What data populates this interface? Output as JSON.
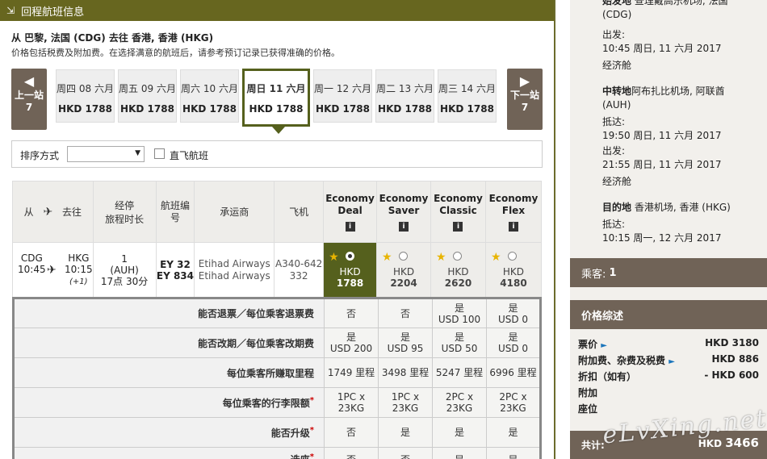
{
  "header": {
    "title": "回程航班信息",
    "icon": "collapse-arrow-icon"
  },
  "route": "从 巴黎, 法国 (CDG) 去往 香港, 香港 (HKG)",
  "note": "价格包括税费及附加费。在选择满意的航班后，请参考预订记录已获得准确的价格。",
  "nav": {
    "prev": [
      "上一站",
      "7"
    ],
    "next": [
      "下一站",
      "7"
    ]
  },
  "dates": [
    {
      "label": "周四 08 六月",
      "price": "HKD 1788"
    },
    {
      "label": "周五 09 六月",
      "price": "HKD 1788"
    },
    {
      "label": "周六 10 六月",
      "price": "HKD 1788"
    },
    {
      "label": "周日 11 六月",
      "price": "HKD 1788",
      "selected": true
    },
    {
      "label": "周一 12 六月",
      "price": "HKD 1788"
    },
    {
      "label": "周二 13 六月",
      "price": "HKD 1788"
    },
    {
      "label": "周三 14 六月",
      "price": "HKD 1788"
    }
  ],
  "sort": {
    "label": "排序方式",
    "value": "",
    "direct_label": "直飞航班"
  },
  "table": {
    "headers": {
      "from": "从",
      "to": "去往",
      "stops": "经停",
      "duration": "旅程时长",
      "flightno": "航班编号",
      "carrier": "承运商",
      "aircraft": "飞机"
    },
    "fares": [
      {
        "name": [
          "Economy",
          "Deal"
        ],
        "currency": "HKD",
        "price": "1788",
        "selected": true
      },
      {
        "name": [
          "Economy",
          "Saver"
        ],
        "currency": "HKD",
        "price": "2204"
      },
      {
        "name": [
          "Economy",
          "Classic"
        ],
        "currency": "HKD",
        "price": "2620"
      },
      {
        "name": [
          "Economy",
          "Flex"
        ],
        "currency": "HKD",
        "price": "4180"
      }
    ],
    "flight": {
      "from_code": "CDG",
      "from_time": "10:45",
      "to_code": "HKG",
      "to_time": "10:15",
      "to_day": "(+1)",
      "stops": "1",
      "via": "(AUH)",
      "duration": "17点 30分",
      "flightnos": [
        "EY 32",
        "EY 834"
      ],
      "carriers": [
        "Etihad Airways",
        "Etihad Airways"
      ],
      "aircraft": [
        "A340-642",
        "332"
      ]
    }
  },
  "details": [
    {
      "q": "能否退票／每位乘客退票费",
      "v": [
        [
          "否"
        ],
        [
          "否"
        ],
        [
          "是",
          "USD 100"
        ],
        [
          "是",
          "USD 0"
        ]
      ]
    },
    {
      "q": "能否改期／每位乘客改期费",
      "v": [
        [
          "是",
          "USD 200"
        ],
        [
          "是",
          "USD 95"
        ],
        [
          "是",
          "USD 50"
        ],
        [
          "是",
          "USD 0"
        ]
      ]
    },
    {
      "q": "每位乘客所赚取里程",
      "v": [
        [
          "1749 里程"
        ],
        [
          "3498 里程"
        ],
        [
          "5247 里程"
        ],
        [
          "6996 里程"
        ]
      ]
    },
    {
      "q": "每位乘客的行李限额",
      "star": "*",
      "v": [
        [
          "1PC x",
          "23KG"
        ],
        [
          "1PC x",
          "23KG"
        ],
        [
          "2PC x",
          "23KG"
        ],
        [
          "2PC x",
          "23KG"
        ]
      ]
    },
    {
      "q": "能否升级",
      "star": "*",
      "v": [
        [
          "否"
        ],
        [
          "是"
        ],
        [
          "是"
        ],
        [
          "是"
        ]
      ]
    },
    {
      "q": "选座",
      "star": "*",
      "v": [
        [
          "否"
        ],
        [
          "否"
        ],
        [
          "是"
        ],
        [
          "是"
        ]
      ]
    }
  ],
  "itinerary": {
    "origin_top": "始发地",
    "origin_airport": "查理戴高乐机场, 法国",
    "origin_code": "(CDG)",
    "dep_label": "出发:",
    "dep_time": "10:45 周日, 11 六月 2017",
    "cabin1": "经济舱",
    "transit_label": "中转地",
    "transit_airport": "阿布扎比机场, 阿联酋",
    "transit_code": "(AUH)",
    "arr_label": "抵达:",
    "transit_arr": "19:50 周日, 11 六月 2017",
    "transit_dep_label": "出发:",
    "transit_dep": "21:55 周日, 11 六月 2017",
    "cabin2": "经济舱",
    "dest_label": "目的地",
    "dest_airport": "香港机场, 香港 (HKG)",
    "dest_arr_label": "抵达:",
    "dest_arr": "10:15 周一, 12 六月 2017"
  },
  "passengers": {
    "label": "乘客:",
    "value": "1"
  },
  "summary": {
    "title": "价格综述",
    "rows": [
      {
        "label": "票价",
        "arrow": "►",
        "value": "HKD 3180"
      },
      {
        "label": "附加费、杂费及税费",
        "arrow": "►",
        "value": "HKD 886"
      },
      {
        "label": "折扣（如有）",
        "value": "- HKD 600"
      },
      {
        "label": "附加",
        "value": ""
      },
      {
        "label": "座位",
        "value": ""
      }
    ],
    "total_label": "共计:",
    "total_currency": "HKD",
    "total_value": "3466"
  },
  "watermark": "eLvXing.net"
}
